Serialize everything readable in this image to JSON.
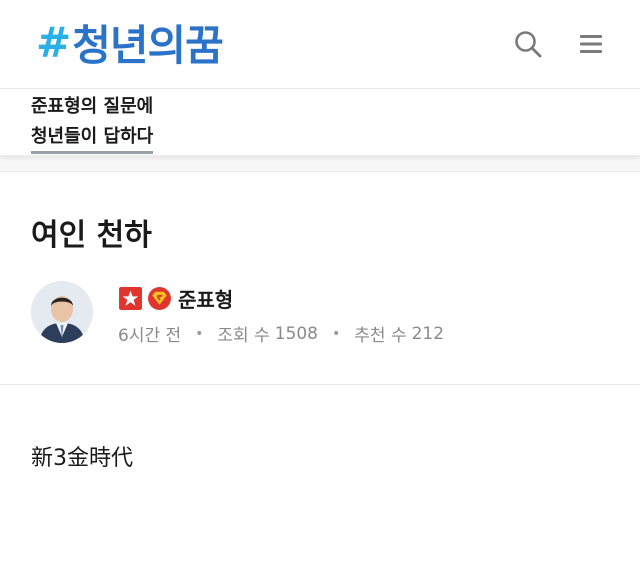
{
  "header": {
    "logo_hash": "#",
    "logo_text": "청년의꿈",
    "search_icon": "search-icon",
    "menu_icon": "menu-icon"
  },
  "subnav": {
    "line1": "준표형의 질문에",
    "line2": "청년들이 답하다"
  },
  "post": {
    "title": "여인 천하",
    "author": {
      "name": "준표형",
      "badges": [
        "star-badge-icon",
        "superman-badge-icon"
      ]
    },
    "meta": {
      "time": "6시간 전",
      "views_label": "조회 수",
      "views": "1508",
      "likes_label": "추천 수",
      "likes": "212",
      "separator": "•"
    },
    "body": "新3金時代"
  },
  "colors": {
    "logo_hash": "#2ab0e6",
    "logo_text": "#2a73c8",
    "meta_text": "#8a8a8a",
    "underline": "#9aa3ab"
  }
}
